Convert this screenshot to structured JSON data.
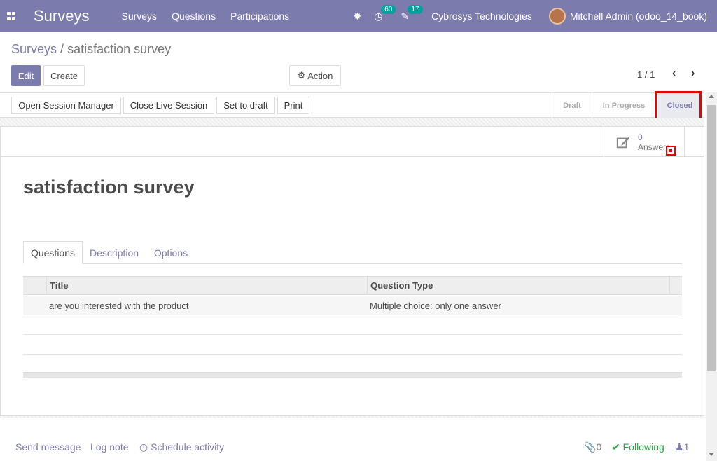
{
  "navbar": {
    "brand": "Surveys",
    "menu": [
      "Surveys",
      "Questions",
      "Participations"
    ],
    "activity_count": "60",
    "message_count": "17",
    "company": "Cybrosys Technologies",
    "user": "Mitchell Admin (odoo_14_book)",
    "color": "#7c7bad"
  },
  "breadcrumb": {
    "parent": "Surveys",
    "separator": "/",
    "current": "satisfaction survey"
  },
  "controls": {
    "edit": "Edit",
    "create": "Create",
    "action": "Action",
    "pager": "1 / 1"
  },
  "statusbar": {
    "buttons": [
      "Open Session Manager",
      "Close Live Session",
      "Set to draft",
      "Print"
    ],
    "stages": [
      "Draft",
      "In Progress",
      "Closed"
    ],
    "active_stage": "Closed"
  },
  "smart_button": {
    "value": "0",
    "label": "Answers"
  },
  "record": {
    "title": "satisfaction survey"
  },
  "tabs": [
    "Questions",
    "Description",
    "Options"
  ],
  "table": {
    "headers": [
      "Title",
      "Question Type"
    ],
    "rows": [
      {
        "title": "are you interested with the product",
        "type": "Multiple choice: only one answer"
      }
    ]
  },
  "chatter": {
    "send_message": "Send message",
    "log_note": "Log note",
    "schedule_activity": "Schedule activity",
    "attachments": "0",
    "following": "Following",
    "followers": "1"
  }
}
